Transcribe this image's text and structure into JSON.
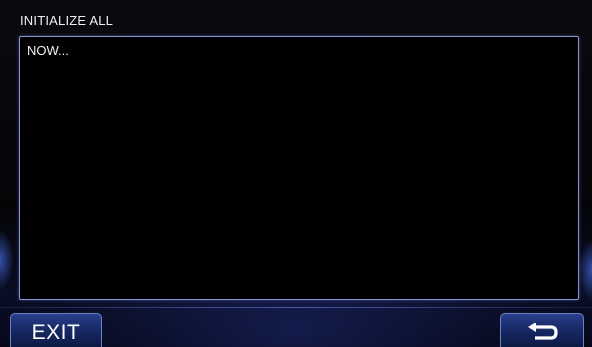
{
  "header": {
    "title": "INITIALIZE ALL"
  },
  "panel": {
    "message": "NOW..."
  },
  "footer": {
    "exit_label": "EXIT",
    "back_icon": "return-arrow-icon"
  },
  "colors": {
    "panel_border": "#8a93d8",
    "button_fill": "#182a66",
    "button_border": "#6d7fc7",
    "background": "#000000"
  }
}
